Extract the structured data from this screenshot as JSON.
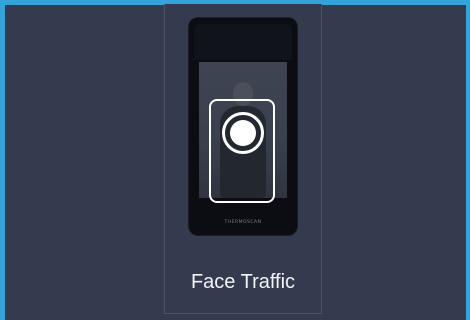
{
  "card": {
    "caption": "Face Traffic",
    "device_brand": "THERMOSCAN"
  },
  "colors": {
    "accent_border": "#34a3d9",
    "background": "#353b4f",
    "card_border": "#4d5468",
    "text": "#f2f3f6"
  },
  "icons": {
    "face_detection": "face-detection-icon"
  }
}
